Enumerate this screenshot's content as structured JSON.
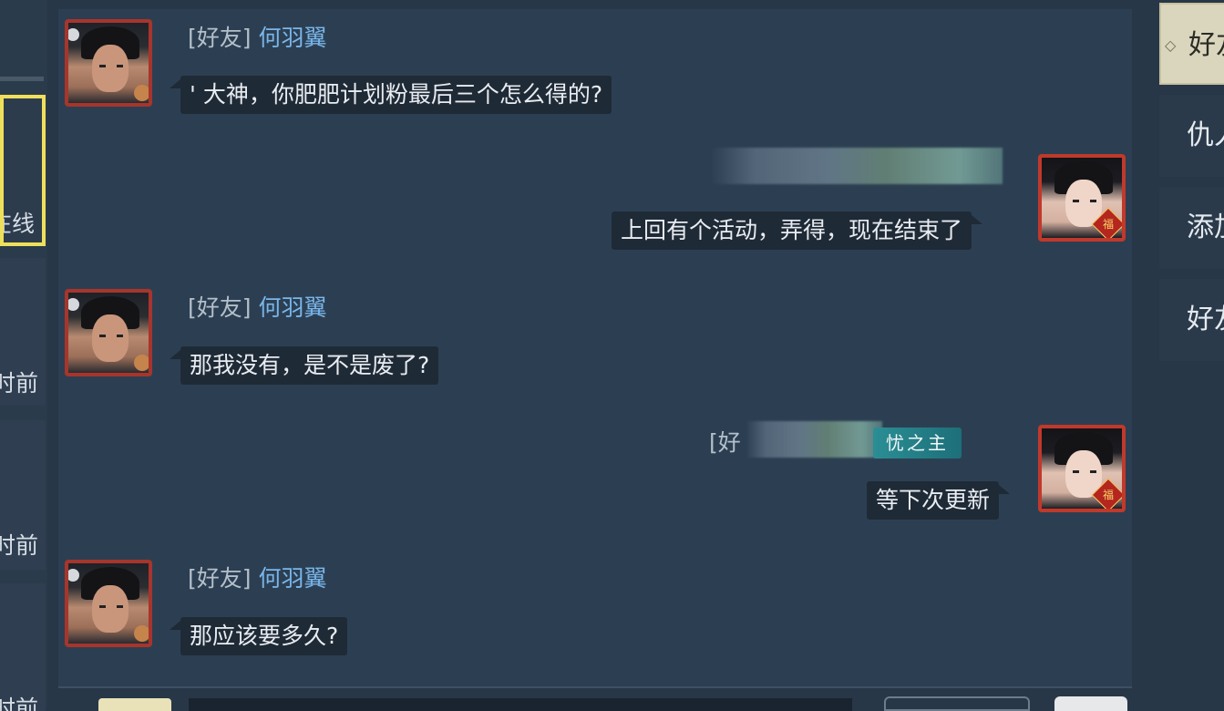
{
  "left_panel": {
    "cards": [
      {
        "label": "在线"
      },
      {
        "label": "时前"
      },
      {
        "label": "时前"
      },
      {
        "label": "时前"
      }
    ]
  },
  "messages": [
    {
      "side": "left",
      "tag": "[好友]",
      "name": "何羽翼",
      "text": "' 大神，你肥肥计划粉最后三个怎么得的?"
    },
    {
      "side": "right",
      "text": "上回有个活动，弄得，现在结束了"
    },
    {
      "side": "left",
      "tag": "[好友]",
      "name": "何羽翼",
      "text": "那我没有，是不是废了?"
    },
    {
      "side": "right",
      "tag": "[好",
      "badge": "忧之主",
      "text": "等下次更新"
    },
    {
      "side": "left",
      "tag": "[好友]",
      "name": "何羽翼",
      "text": "那应该要多久?"
    }
  ],
  "avatar_badge": "福",
  "right_tabs": [
    {
      "label": "好友",
      "active": true
    },
    {
      "label": "仇人",
      "active": false
    },
    {
      "label": "添加",
      "active": false
    },
    {
      "label": "好友",
      "active": false
    }
  ]
}
